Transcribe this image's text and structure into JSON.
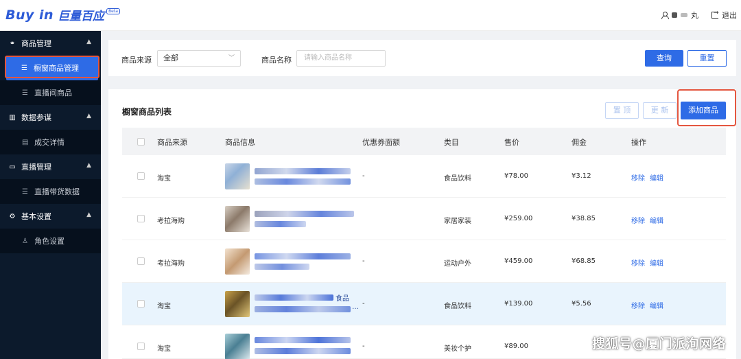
{
  "header": {
    "logo_text": "Buy in",
    "logo_cn": "巨量百应",
    "logo_badge": "Beta",
    "user_suffix": "丸",
    "logout_label": "退出"
  },
  "sidebar": {
    "groups": [
      {
        "label": "商品管理",
        "icon": "product-icon",
        "items": [
          "橱窗商品管理",
          "直播间商品"
        ]
      },
      {
        "label": "数据参谋",
        "icon": "chart-icon",
        "items": [
          "成交详情"
        ]
      },
      {
        "label": "直播管理",
        "icon": "video-icon",
        "items": [
          "直播带货数据"
        ]
      },
      {
        "label": "基本设置",
        "icon": "gear-icon",
        "items": [
          "角色设置"
        ]
      }
    ]
  },
  "filter": {
    "source_label": "商品来源",
    "source_value": "全部",
    "name_label": "商品名称",
    "name_placeholder": "请输入商品名称",
    "query_label": "查询",
    "reset_label": "重置"
  },
  "list": {
    "title": "橱窗商品列表",
    "top_label": "置 顶",
    "update_label": "更 新",
    "add_label": "添加商品",
    "columns": [
      "商品来源",
      "商品信息",
      "优惠券面额",
      "类目",
      "售价",
      "佣金",
      "操作"
    ],
    "rows": [
      {
        "source": "淘宝",
        "coupon": "-",
        "category": "食品饮料",
        "price": "¥78.00",
        "commission": "¥3.12",
        "remove": "移除",
        "edit": "编辑",
        "title_visible": "",
        "sub_visible": ""
      },
      {
        "source": "考拉海购",
        "coupon": "-",
        "category": "家居家装",
        "price": "¥259.00",
        "commission": "¥38.85",
        "remove": "移除",
        "edit": "编辑",
        "title_visible": "",
        "sub_visible": ""
      },
      {
        "source": "考拉海购",
        "coupon": "-",
        "category": "运动户外",
        "price": "¥459.00",
        "commission": "¥68.85",
        "remove": "移除",
        "edit": "编辑",
        "title_visible": "",
        "sub_visible": ""
      },
      {
        "source": "淘宝",
        "coupon": "-",
        "category": "食品饮料",
        "price": "¥139.00",
        "commission": "¥5.56",
        "remove": "移除",
        "edit": "编辑",
        "title_visible": "食品",
        "sub_visible": "…"
      },
      {
        "source": "淘宝",
        "coupon": "-",
        "category": "美妆个护",
        "price": "¥89.00",
        "commission": "",
        "remove": "",
        "edit": "",
        "title_visible": "",
        "sub_visible": ""
      }
    ]
  },
  "watermark": "搜狐号@厦门派洵网络",
  "colors": {
    "primary": "#2e6be6",
    "sidebar_bg": "#0c1a2c",
    "highlight_box": "#e4563f"
  }
}
